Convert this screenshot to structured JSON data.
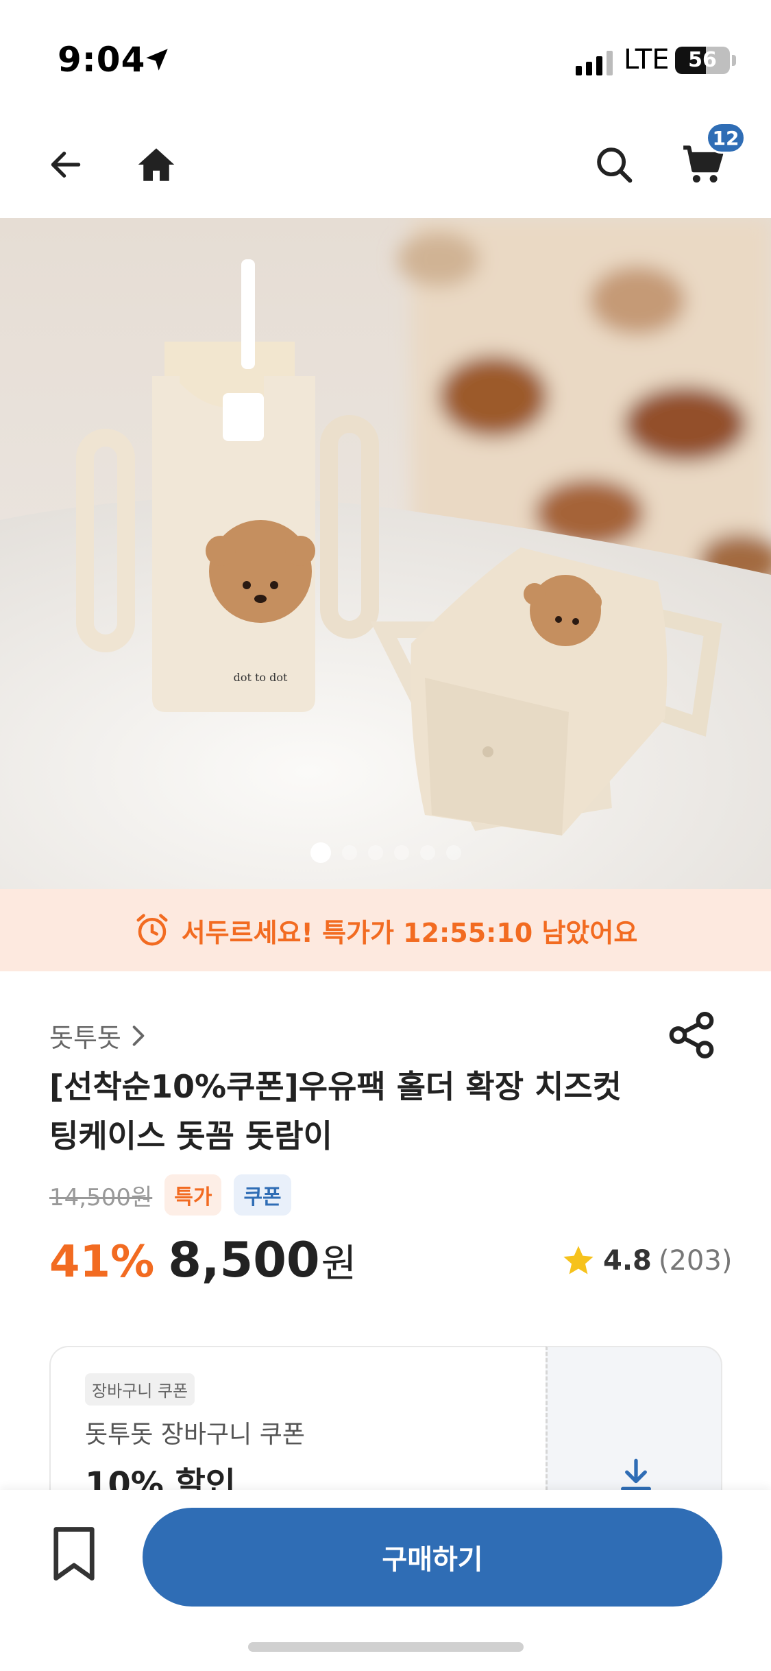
{
  "status_bar": {
    "time": "9:04",
    "network": "LTE",
    "battery": "56",
    "battery_level": 0.56
  },
  "nav": {
    "icons": [
      "back-arrow-icon",
      "home-icon",
      "search-icon",
      "cart-icon"
    ],
    "cart_count": "12"
  },
  "gallery": {
    "image_count": 6,
    "active_index": 0,
    "product_print": "dot to dot"
  },
  "timer_banner": {
    "text": "서두르세요! 특가가 12:55:10 남았어요",
    "icon": "alarm-clock-icon"
  },
  "product": {
    "brand": "돗투돗",
    "title_line1": "[선착순10%쿠폰]우유팩 홀더 확장 치즈컷",
    "title_line2": "팅케이스 돗꼼 돗람이",
    "original_price": "14,500원",
    "tags": [
      "특가",
      "쿠폰"
    ],
    "discount": "41%",
    "price": "8,500",
    "currency": "원",
    "rating": "4.8",
    "review_count": "(203)"
  },
  "coupon": {
    "chip": "장바구니 쿠폰",
    "name": "돗투돗 장바구니 쿠폰",
    "amount": "10% 할인"
  },
  "bottom_bar": {
    "buy_label": "구매하기"
  },
  "colors": {
    "accent_orange": "#f26b21",
    "primary_blue": "#2f6db5",
    "banner_bg": "#fde9df"
  }
}
